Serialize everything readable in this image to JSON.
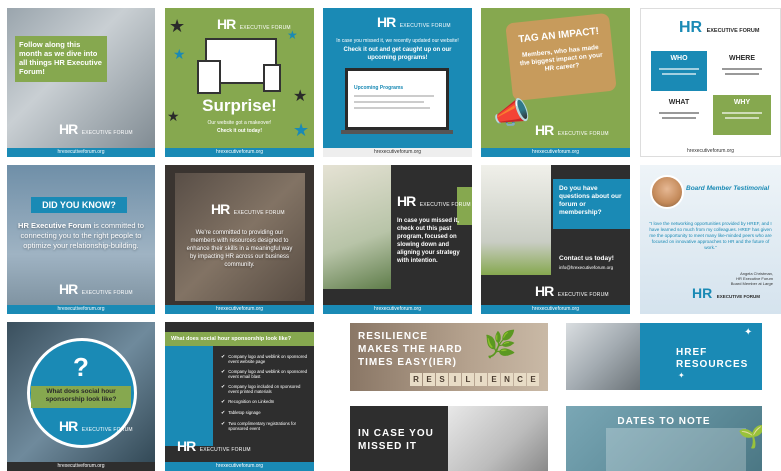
{
  "t1": {
    "text": "Follow along this month as we dive into all things HR Executive Forum!",
    "footer": "hrexecutiveforum.org"
  },
  "t2": {
    "title": "Surprise!",
    "sub1": "Our website got a makeover!",
    "sub2": "Check it out today!",
    "footer": "hrexecutiveforum.org"
  },
  "t3": {
    "line1": "In case you missed it, we recently updated our website!",
    "line2": "Check it out and get caught up on our upcoming programs!",
    "screen_title": "Upcoming Programs",
    "footer": "hrexecutiveforum.org"
  },
  "t4": {
    "tag": "TAG AN IMPACT!",
    "bubble": "Members, who has made the biggest impact on your HR career?",
    "footer": "hrexecutiveforum.org"
  },
  "t5": {
    "logo_text": "EXECUTIVE FORUM",
    "who": "WHO",
    "where": "WHERE",
    "what": "WHAT",
    "why": "WHY",
    "footer": "hrexecutiveforum.org"
  },
  "t6": {
    "badge": "DID YOU KNOW?",
    "bold": "HR Executive Forum",
    "text": "is committed to connecting you to the right people to optimize your relationship-building.",
    "footer": "hrexecutiveforum.org"
  },
  "t7": {
    "text": "We're committed to providing our members with resources designed to enhance their skills in a meaningful way by impacting HR across our business community.",
    "footer": "hrexecutiveforum.org"
  },
  "t8": {
    "text": "In case you missed it, check out this past program, focused on slowing down and aligning your strategy with intention.",
    "footer": "hrexecutiveforum.org"
  },
  "t9": {
    "q": "Do you have questions about our forum or membership?",
    "contact": "Contact us today!",
    "email": "info@hrexecutiveforum.org",
    "footer": "hrexecutiveforum.org"
  },
  "t10": {
    "title": "Board Member Testimonial",
    "quote": "\"I love the networking opportunities provided by HREF, and I have learned so much from my colleagues. HREF has given me the opportunity to meet many like-minded peers who are focused on innovative approaches to HR and the future of work.\"",
    "name": "Angela Christman,",
    "role1": "HR Executive Forum",
    "role2": "Board Member at Large"
  },
  "t11": {
    "q": "What does social hour sponsorship look like?",
    "footer": "hrexecutiveforum.org"
  },
  "t12": {
    "header": "What does social hour sponsorship look like?",
    "items": [
      "Company logo and weblink on sponsored event website page",
      "Company logo and weblink on sponsored event email blast",
      "Company logo included on sponsored event printed materials",
      "Recognition on LinkedIn",
      "Tabletop signage",
      "Two complimentary registrations for sponsored event"
    ],
    "footer": "hrexecutiveforum.org"
  },
  "t13": {
    "line1": "RESILIENCE",
    "line2": "MAKES THE HARD",
    "line3": "TIMES EASY(IER)",
    "blocks": [
      "R",
      "E",
      "S",
      "I",
      "L",
      "I",
      "E",
      "N",
      "C",
      "E"
    ]
  },
  "t14": {
    "line1": "HREF",
    "line2": "RESOURCES"
  },
  "t15": {
    "line1": "IN CASE YOU",
    "line2": "MISSED IT"
  },
  "t16": {
    "title": "DATES TO NOTE"
  },
  "logo": {
    "hr": "HR",
    "ef": "EXECUTIVE FORUM"
  }
}
